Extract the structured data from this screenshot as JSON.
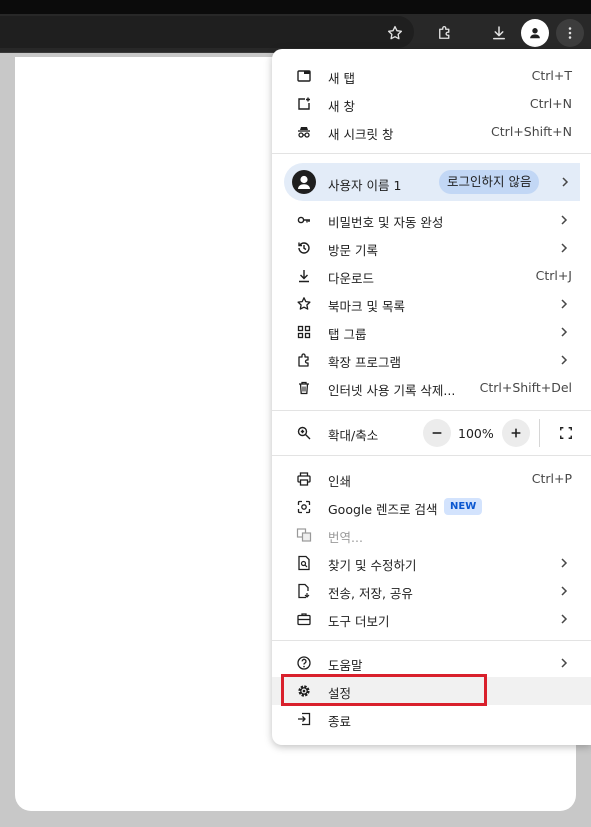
{
  "menu": {
    "new_tab": {
      "label": "새 탭",
      "shortcut": "Ctrl+T"
    },
    "new_window": {
      "label": "새 창",
      "shortcut": "Ctrl+N"
    },
    "incognito": {
      "label": "새 시크릿 창",
      "shortcut": "Ctrl+Shift+N"
    },
    "profile": {
      "name": "사용자 이름 1",
      "status": "로그인하지 않음"
    },
    "passwords": {
      "label": "비밀번호 및 자동 완성"
    },
    "history": {
      "label": "방문 기록"
    },
    "downloads": {
      "label": "다운로드",
      "shortcut": "Ctrl+J"
    },
    "bookmarks": {
      "label": "북마크 및 목록"
    },
    "tab_groups": {
      "label": "탭 그룹"
    },
    "extensions": {
      "label": "확장 프로그램"
    },
    "clear_data": {
      "label": "인터넷 사용 기록 삭제...",
      "shortcut": "Ctrl+Shift+Del"
    },
    "zoom": {
      "label": "확대/축소",
      "value": "100%"
    },
    "print": {
      "label": "인쇄",
      "shortcut": "Ctrl+P"
    },
    "lens": {
      "label": "Google 렌즈로 검색",
      "badge": "NEW"
    },
    "translate": {
      "label": "번역..."
    },
    "find_edit": {
      "label": "찾기 및 수정하기"
    },
    "cast_save_share": {
      "label": "전송, 저장, 공유"
    },
    "more_tools": {
      "label": "도구 더보기"
    },
    "help": {
      "label": "도움말"
    },
    "settings": {
      "label": "설정"
    },
    "exit": {
      "label": "종료"
    }
  },
  "colors": {
    "highlight": "#d9202c",
    "profile_bg": "#e3ecf8",
    "badge_bg": "#d3e3fd",
    "badge_text": "#0b57d0"
  }
}
